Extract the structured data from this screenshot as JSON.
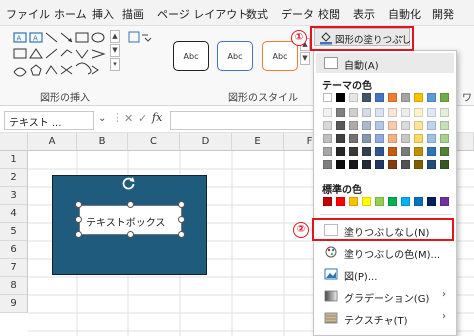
{
  "ribbon": {
    "tabs": [
      "ファイル",
      "ホーム",
      "挿入",
      "描画",
      "ページ レイアウト",
      "数式",
      "データ",
      "校閲",
      "表示",
      "自動化",
      "開発"
    ],
    "groups": {
      "insert_shapes": "図形の挿入",
      "shape_styles": "図形のスタイル",
      "partial": "ワ"
    },
    "style_presets": [
      "Abc",
      "Abc",
      "Abc"
    ],
    "fill_button_label": "図形の塗りつぶし"
  },
  "formula_bar": {
    "name_box": "テキスト ...",
    "fx": "fx"
  },
  "grid": {
    "columns": [
      "A",
      "B",
      "C",
      "D",
      "E",
      "F",
      "G",
      "H",
      "I"
    ],
    "rows": [
      "1",
      "2",
      "3",
      "4",
      "5",
      "6",
      "7",
      "8",
      "9"
    ],
    "shape_text": "テキストボックス"
  },
  "menu": {
    "auto_top": "自動(A)",
    "theme_colors_title": "テーマの色",
    "standard_colors_title": "標準の色",
    "no_fill": "塗りつぶしなし(N)",
    "more_colors": "塗りつぶしの色(M)...",
    "picture": "図(P)...",
    "gradient": "グラデーション(G)",
    "texture": "テクスチャ(T)",
    "theme_colors_row": [
      "#ffffff",
      "#000000",
      "#e7e6e6",
      "#44546a",
      "#4472c4",
      "#ed7d31",
      "#a5a5a5",
      "#ffc000",
      "#5b9bd5",
      "#70ad47"
    ],
    "theme_shades": [
      [
        "#f2f2f2",
        "#7f7f7f",
        "#d0cece",
        "#d6dce5",
        "#dae3f3",
        "#fbe5d6",
        "#ededed",
        "#fff2cc",
        "#deebf7",
        "#e2f0d9"
      ],
      [
        "#d9d9d9",
        "#595959",
        "#aeabab",
        "#adb9ca",
        "#b4c7e7",
        "#f8cbad",
        "#dbdbdb",
        "#ffe699",
        "#bdd7ee",
        "#c5e0b4"
      ],
      [
        "#bfbfbf",
        "#404040",
        "#767171",
        "#8497b0",
        "#8faadc",
        "#f4b183",
        "#c9c9c9",
        "#ffd966",
        "#9dc3e6",
        "#a9d18e"
      ],
      [
        "#a6a6a6",
        "#262626",
        "#3b3838",
        "#333f50",
        "#2f5597",
        "#c55a11",
        "#7b7b7b",
        "#bf9000",
        "#2e75b6",
        "#548235"
      ],
      [
        "#7f7f7f",
        "#0d0d0d",
        "#181717",
        "#222a35",
        "#1f3864",
        "#843c0c",
        "#525252",
        "#7f6000",
        "#1f4e79",
        "#385723"
      ]
    ],
    "standard_colors": [
      "#c00000",
      "#ff0000",
      "#ffc000",
      "#ffff00",
      "#92d050",
      "#00b050",
      "#00b0f0",
      "#0070c0",
      "#002060",
      "#7030a0"
    ]
  },
  "annotations": {
    "step1": "①",
    "step2": "②",
    "color": "#e3141d"
  },
  "colors": {
    "shape_fill": "#1f5b7d",
    "ribbon_bg": "#f8f8f8"
  }
}
